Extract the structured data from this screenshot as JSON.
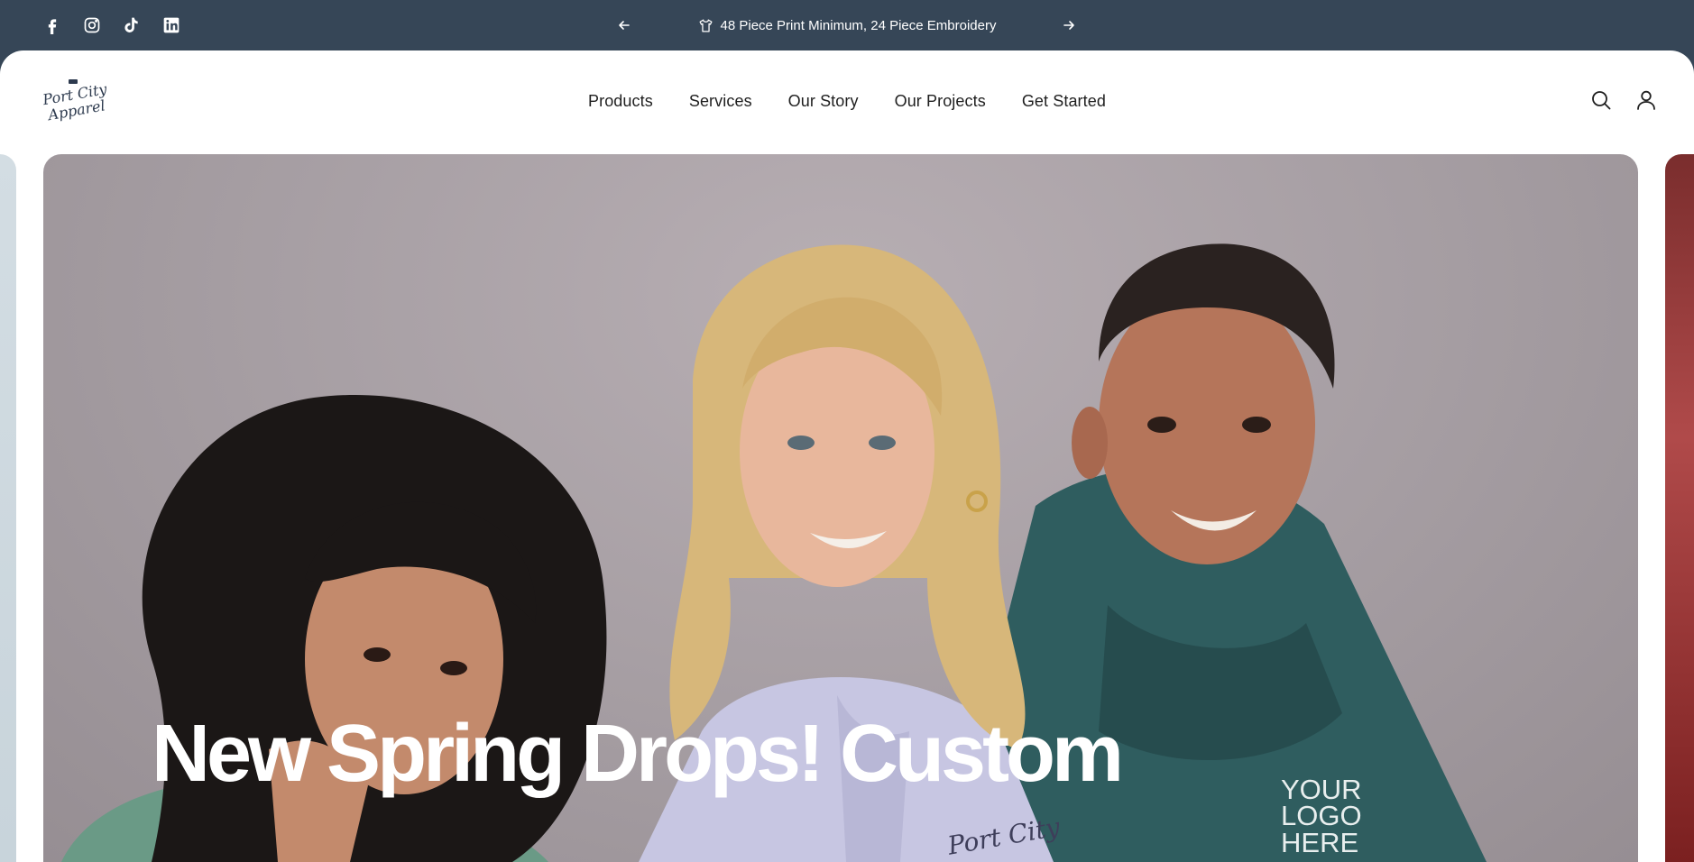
{
  "announcement": {
    "message": "48 Piece Print Minimum, 24 Piece Embroidery",
    "icon": "tshirt-icon",
    "prev_icon": "arrow-left-icon",
    "next_icon": "arrow-right-icon"
  },
  "social": [
    "facebook-icon",
    "instagram-icon",
    "tiktok-icon",
    "linkedin-icon"
  ],
  "brand": {
    "logo_line1": "Port City",
    "logo_line2": "Apparel"
  },
  "nav": {
    "items": [
      "Products",
      "Services",
      "Our Story",
      "Our Projects",
      "Get Started"
    ]
  },
  "header_icons": [
    "search-icon",
    "account-icon"
  ],
  "hero": {
    "headline": "New Spring Drops! Custom",
    "shirt_print": "YOUR\nLOGO\nHERE",
    "hoodie_print": "Port City"
  },
  "colors": {
    "topbar": "#364657",
    "text": "#1f1f1f",
    "white": "#ffffff"
  }
}
